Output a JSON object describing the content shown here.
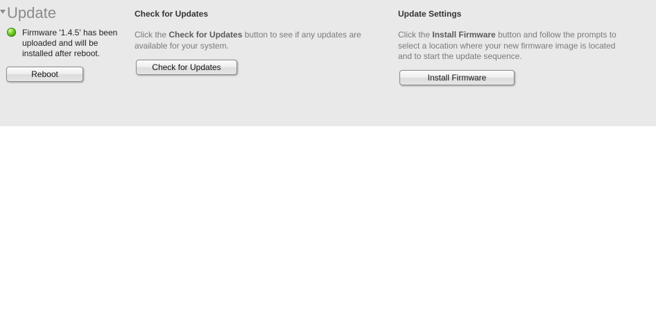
{
  "update": {
    "title": "Update",
    "status_text": "Firmware '1.4.5' has been uploaded and will be installed after reboot.",
    "status_color": "#5cc01e",
    "reboot_label": "Reboot"
  },
  "check": {
    "title": "Check for Updates",
    "desc_prefix": "Click the ",
    "desc_bold": "Check for Updates",
    "desc_suffix": " button to see if any updates are available for your system.",
    "button_label": "Check for Updates"
  },
  "settings": {
    "title": "Update Settings",
    "desc_prefix": "Click the ",
    "desc_bold": "Install Firmware",
    "desc_suffix": " button and follow the prompts to select a location where your new firmware image is located and to start the update sequence.",
    "button_label": "Install Firmware"
  }
}
